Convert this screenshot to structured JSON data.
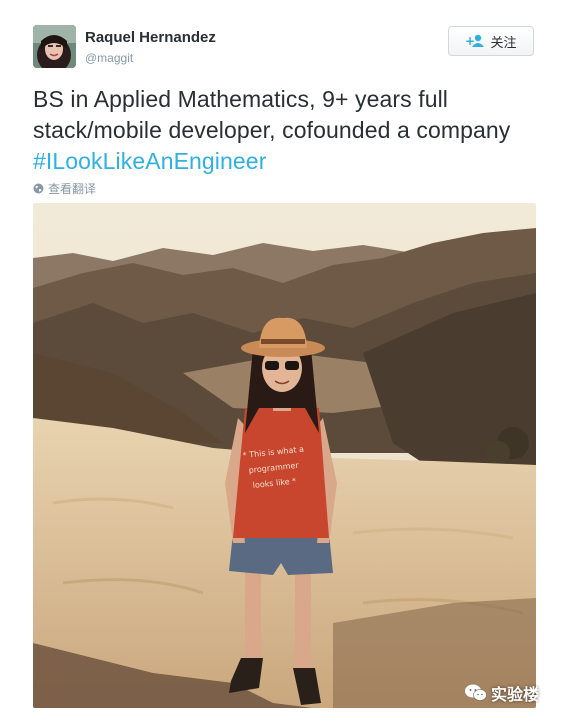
{
  "user": {
    "display_name": "Raquel Hernandez",
    "handle": "@maggit"
  },
  "follow_button": {
    "label": "关注",
    "icon": "add-user-icon"
  },
  "tweet": {
    "text_plain": "BS in Applied Mathematics, 9+ years full stack/mobile developer, cofounded a company ",
    "hashtag": "#ILookLikeAnEngineer"
  },
  "translate": {
    "label": "查看翻译",
    "icon": "globe-icon"
  },
  "photo": {
    "shirt_text": "* This is what a programmer looks like *"
  },
  "watermark": {
    "label": "实验楼",
    "icon": "wechat-icon"
  },
  "colors": {
    "hashtag": "#2fb0e3",
    "handle": "#8899a6",
    "text": "#292f33"
  }
}
